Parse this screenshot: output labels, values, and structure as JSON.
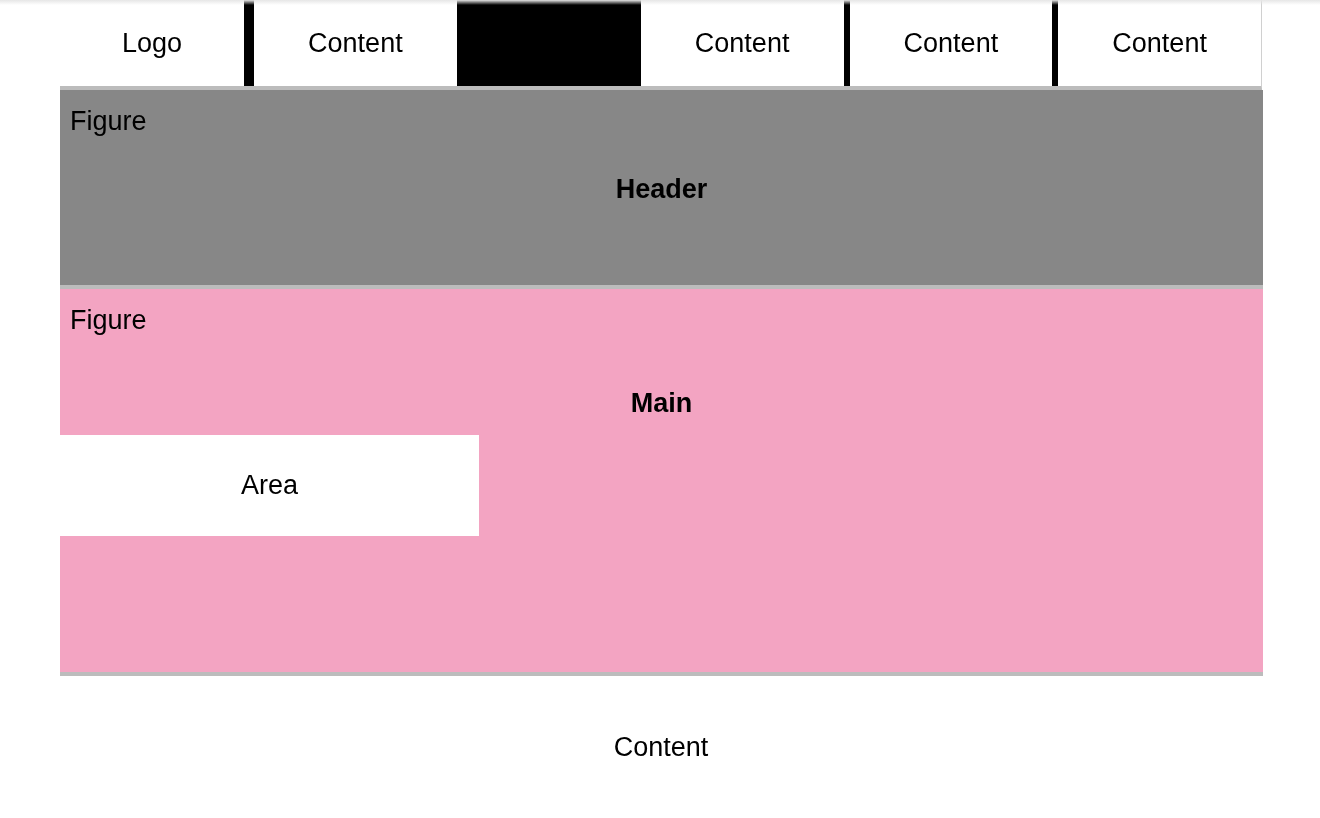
{
  "nav": {
    "items": [
      {
        "kind": "logo",
        "label": "Logo"
      },
      {
        "kind": "divider"
      },
      {
        "kind": "link",
        "label": "Content"
      },
      {
        "kind": "block"
      },
      {
        "kind": "link",
        "label": "Content"
      },
      {
        "kind": "divider"
      },
      {
        "kind": "link",
        "label": "Content"
      },
      {
        "kind": "divider"
      },
      {
        "kind": "link",
        "label": "Content"
      }
    ]
  },
  "sections": [
    {
      "kind": "header",
      "caption": "Figure",
      "title": "Header"
    },
    {
      "kind": "main",
      "caption": "Figure",
      "title": "Main",
      "area": "Area"
    }
  ],
  "footer": {
    "text": "Content"
  }
}
